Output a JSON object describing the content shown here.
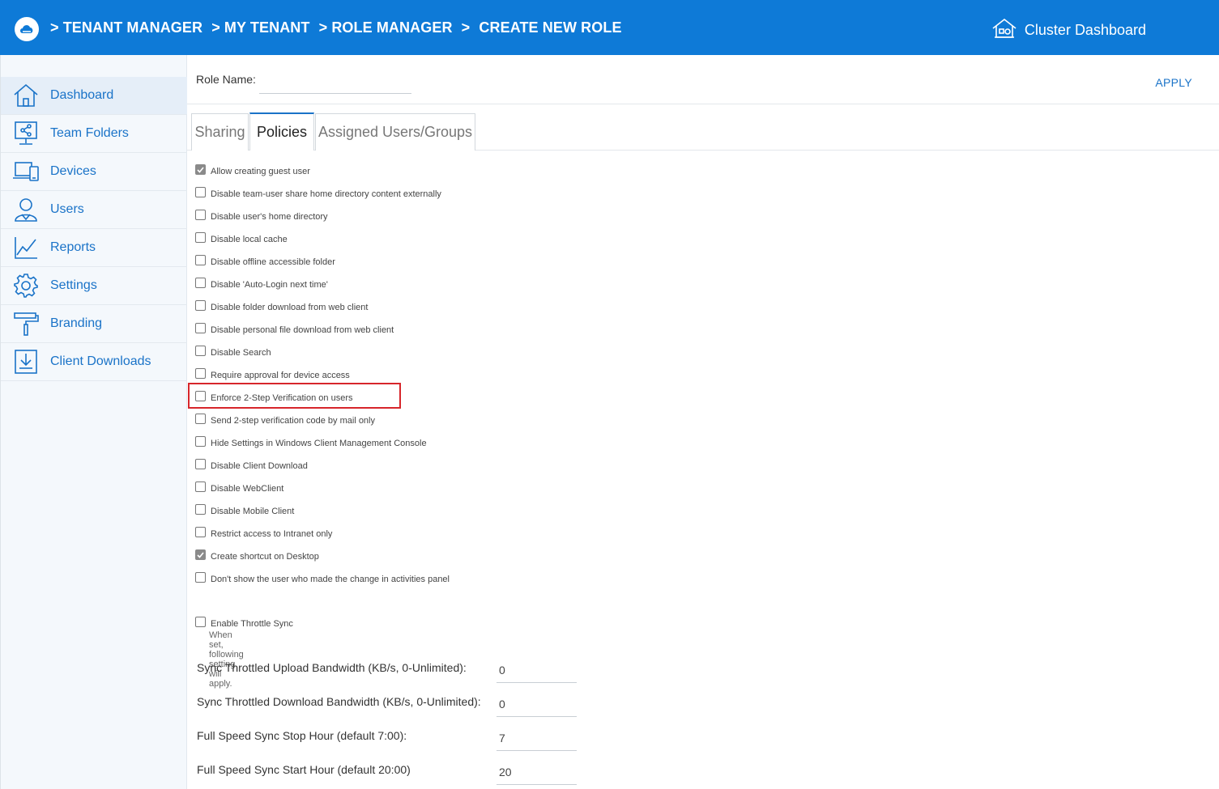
{
  "header": {
    "breadcrumbs": [
      "> TENANT MANAGER",
      "> MY TENANT",
      "> ROLE MANAGER",
      ">",
      "CREATE NEW ROLE"
    ],
    "cluster_label": "Cluster Dashboard",
    "bg_color": "#0e7ad7"
  },
  "sidebar": {
    "items": [
      {
        "label": "Dashboard",
        "icon": "home-icon"
      },
      {
        "label": "Team Folders",
        "icon": "team-folders-icon"
      },
      {
        "label": "Devices",
        "icon": "devices-icon"
      },
      {
        "label": "Users",
        "icon": "users-icon"
      },
      {
        "label": "Reports",
        "icon": "reports-icon"
      },
      {
        "label": "Settings",
        "icon": "gear-icon"
      },
      {
        "label": "Branding",
        "icon": "paint-roller-icon"
      },
      {
        "label": "Client Downloads",
        "icon": "download-icon"
      }
    ]
  },
  "role": {
    "label": "Role Name:",
    "value": "",
    "apply_label": "APPLY"
  },
  "tabs": [
    {
      "label": "Sharing",
      "active": false
    },
    {
      "label": "Policies",
      "active": true
    },
    {
      "label": "Assigned Users/Groups",
      "active": false
    }
  ],
  "policies": [
    {
      "label": "Allow creating guest user",
      "checked": true
    },
    {
      "label": "Disable team-user share home directory content externally",
      "checked": false
    },
    {
      "label": "Disable user's home directory",
      "checked": false
    },
    {
      "label": "Disable local cache",
      "checked": false
    },
    {
      "label": "Disable offline accessible folder",
      "checked": false
    },
    {
      "label": "Disable 'Auto-Login next time'",
      "checked": false
    },
    {
      "label": "Disable folder download from web client",
      "checked": false
    },
    {
      "label": "Disable personal file download from web client",
      "checked": false
    },
    {
      "label": "Disable Search",
      "checked": false
    },
    {
      "label": "Require approval for device access",
      "checked": false
    },
    {
      "label": "Enforce 2-Step Verification on users",
      "checked": false,
      "highlighted": true
    },
    {
      "label": "Send 2-step verification code by mail only",
      "checked": false
    },
    {
      "label": "Hide Settings in Windows Client Management Console",
      "checked": false
    },
    {
      "label": "Disable Client Download",
      "checked": false
    },
    {
      "label": "Disable WebClient",
      "checked": false
    },
    {
      "label": "Disable Mobile Client",
      "checked": false
    },
    {
      "label": "Restrict access to Intranet only",
      "checked": false
    },
    {
      "label": "Create shortcut on Desktop",
      "checked": true
    },
    {
      "label": "Don't show the user who made the change in activities panel",
      "checked": false
    }
  ],
  "throttle": {
    "label": "Enable Throttle Sync",
    "hint": "When set, following setting will apply.",
    "checked": false
  },
  "fields": [
    {
      "label": "Sync Throttled Upload Bandwidth (KB/s, 0-Unlimited):",
      "value": "0"
    },
    {
      "label": "Sync Throttled Download Bandwidth (KB/s, 0-Unlimited):",
      "value": "0"
    },
    {
      "label": "Full Speed Sync Stop Hour (default 7:00):",
      "value": "7"
    },
    {
      "label": "Full Speed Sync Start Hour (default 20:00)",
      "value": "20"
    }
  ]
}
